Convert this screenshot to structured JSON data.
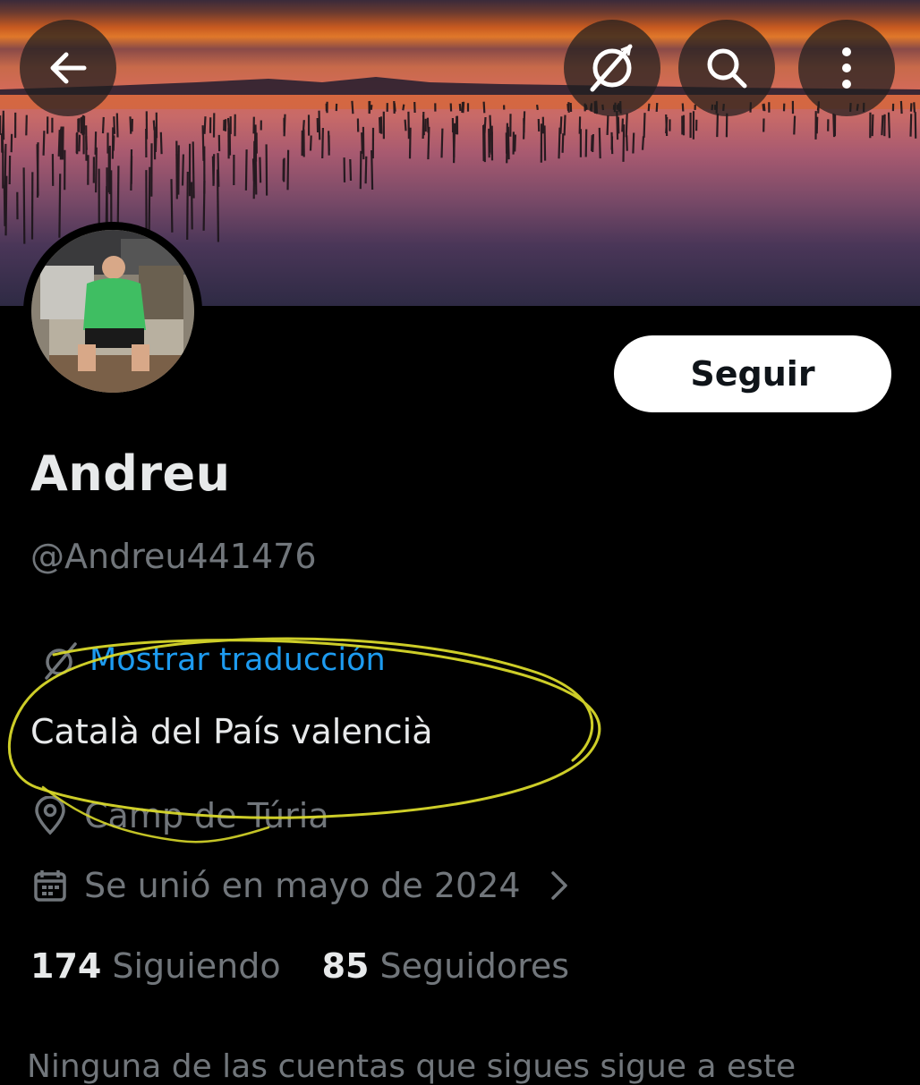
{
  "header": {
    "back_icon": "arrow-left-icon",
    "translate_icon": "translate-off-icon",
    "search_icon": "search-icon",
    "more_icon": "more-vertical-icon"
  },
  "profile": {
    "follow_label": "Seguir",
    "name": "Andreu",
    "handle": "@Andreu441476",
    "translate_label": "Mostrar traducción",
    "bio": "Català del País valencià",
    "location": "Camp de Túria",
    "joined": "Se unió en mayo de 2024",
    "following_count": "174",
    "following_label": "Siguiendo",
    "followers_count": "85",
    "followers_label": "Seguidores",
    "followed_by_note": "Ninguna de las cuentas que sigues sigue a este"
  },
  "colors": {
    "accent": "#1d9bf0",
    "highlight": "#d8d82a",
    "secondary_text": "#71767b"
  }
}
